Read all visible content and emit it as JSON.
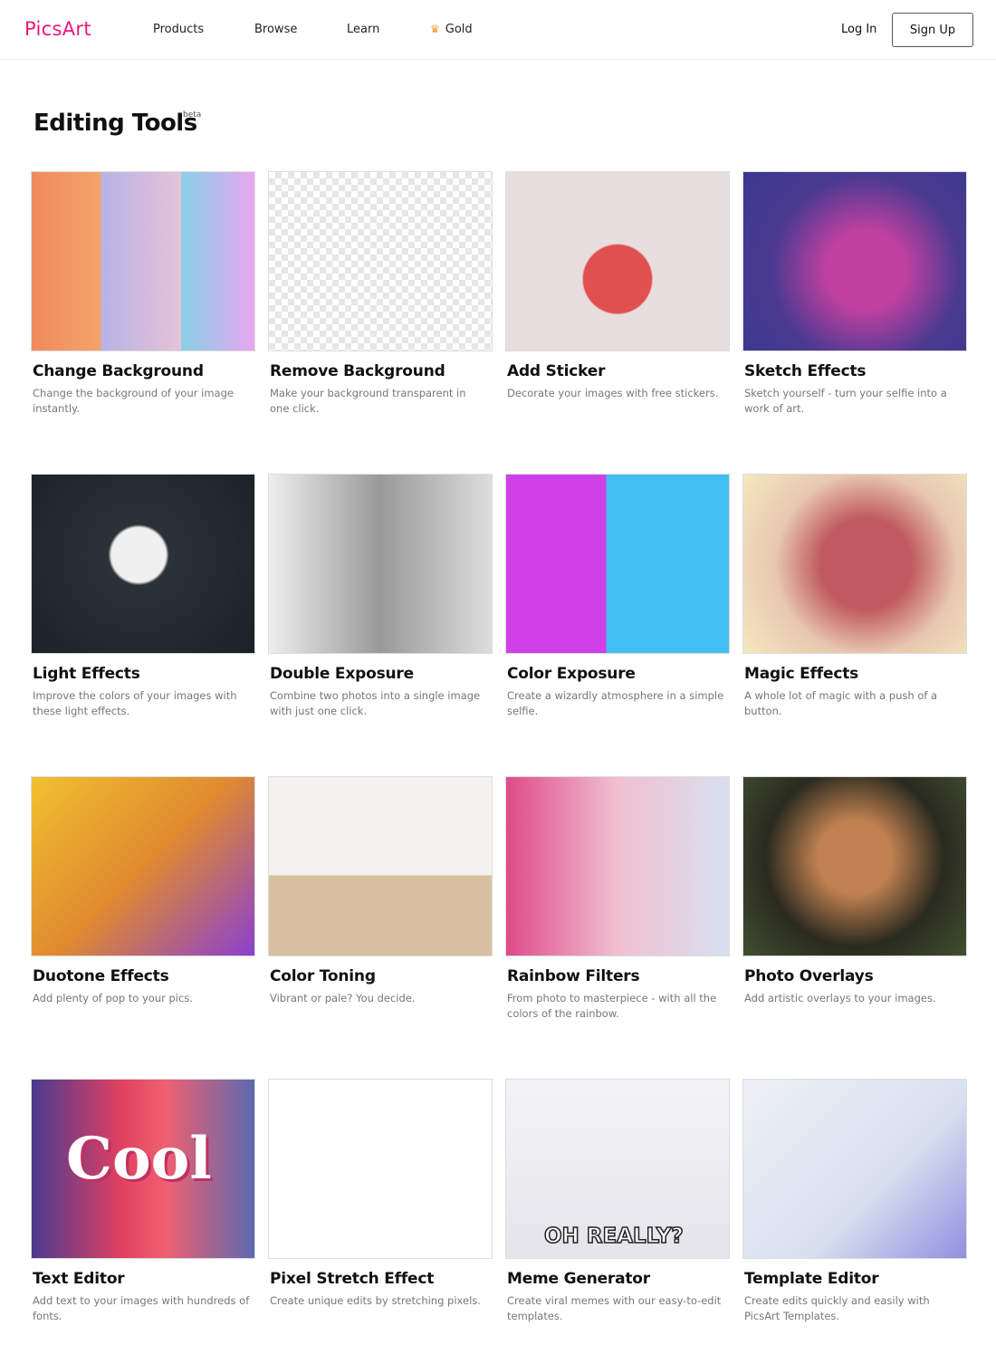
{
  "header": {
    "logo": "PicsArt",
    "nav": [
      "Products",
      "Browse",
      "Learn",
      "Gold"
    ],
    "login": "Log In",
    "signup": "Sign Up",
    "gold_icon": "crown-icon"
  },
  "page": {
    "title": "Editing Tools",
    "badge": "beta"
  },
  "tools": [
    {
      "title": "Change Background",
      "desc": "Change the background of your image instantly."
    },
    {
      "title": "Remove Background",
      "desc": "Make your background transparent in one click."
    },
    {
      "title": "Add Sticker",
      "desc": "Decorate your images with free stickers."
    },
    {
      "title": "Sketch Effects",
      "desc": "Sketch yourself - turn your selfie into a work of art."
    },
    {
      "title": "Light Effects",
      "desc": "Improve the colors of your images with these light effects."
    },
    {
      "title": "Double Exposure",
      "desc": "Combine two photos into a single image with just one click."
    },
    {
      "title": "Color Exposure",
      "desc": "Create a wizardly atmosphere in a simple selfie."
    },
    {
      "title": "Magic Effects",
      "desc": "A whole lot of magic with a push of a button."
    },
    {
      "title": "Duotone Effects",
      "desc": "Add plenty of pop to your pics."
    },
    {
      "title": "Color Toning",
      "desc": "Vibrant or pale? You decide."
    },
    {
      "title": "Rainbow Filters",
      "desc": "From photo to masterpiece - with all the colors of the rainbow."
    },
    {
      "title": "Photo Overlays",
      "desc": "Add artistic overlays to your images."
    },
    {
      "title": "Text Editor",
      "desc": "Add text to your images with hundreds of fonts."
    },
    {
      "title": "Pixel Stretch Effect",
      "desc": "Create unique edits by stretching pixels."
    },
    {
      "title": "Meme Generator",
      "desc": "Create viral memes with our easy-to-edit templates."
    },
    {
      "title": "Template Editor",
      "desc": "Create edits quickly and easily with PicsArt Templates."
    }
  ],
  "image_text": {
    "cool": "Cool",
    "meme": "OH REALLY?"
  },
  "colors": {
    "brand": "#e8197d",
    "gold": "#f39a2d"
  }
}
